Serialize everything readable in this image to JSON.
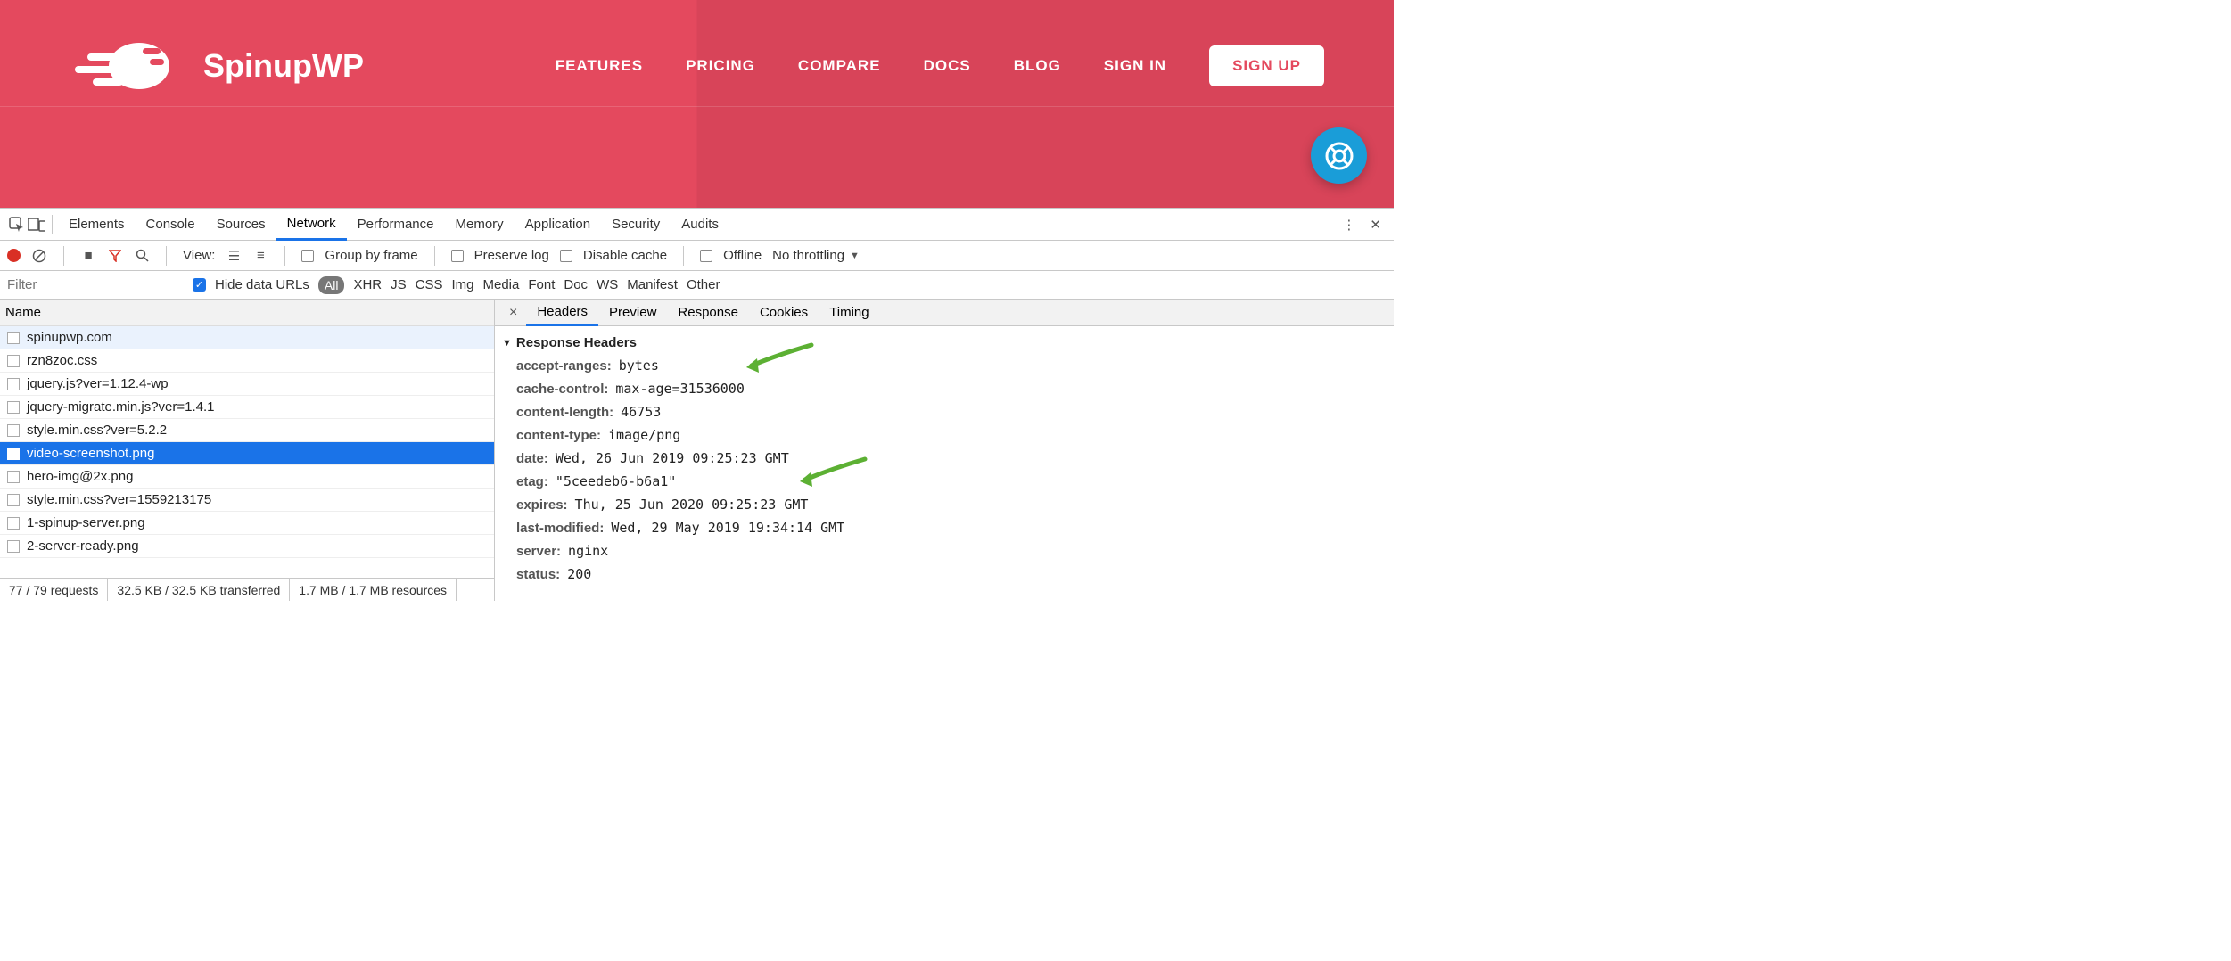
{
  "site": {
    "brand": "SpinupWP",
    "nav": [
      "FEATURES",
      "PRICING",
      "COMPARE",
      "DOCS",
      "BLOG",
      "SIGN IN"
    ],
    "signup": "SIGN UP"
  },
  "devtools": {
    "tabs": [
      "Elements",
      "Console",
      "Sources",
      "Network",
      "Performance",
      "Memory",
      "Application",
      "Security",
      "Audits"
    ],
    "active_tab": "Network",
    "toolbar": {
      "view": "View:",
      "group": "Group by frame",
      "preserve": "Preserve log",
      "disable_cache": "Disable cache",
      "offline": "Offline",
      "throttling": "No throttling"
    },
    "filter": {
      "placeholder": "Filter",
      "hide": "Hide data URLs",
      "types": [
        "All",
        "XHR",
        "JS",
        "CSS",
        "Img",
        "Media",
        "Font",
        "Doc",
        "WS",
        "Manifest",
        "Other"
      ]
    },
    "requests": {
      "header": "Name",
      "rows": [
        "spinupwp.com",
        "rzn8zoc.css",
        "jquery.js?ver=1.12.4-wp",
        "jquery-migrate.min.js?ver=1.4.1",
        "style.min.css?ver=5.2.2",
        "video-screenshot.png",
        "hero-img@2x.png",
        "style.min.css?ver=1559213175",
        "1-spinup-server.png",
        "2-server-ready.png"
      ],
      "selected_index": 5,
      "status": {
        "requests": "77 / 79 requests",
        "transferred": "32.5 KB / 32.5 KB transferred",
        "resources": "1.7 MB / 1.7 MB resources"
      }
    },
    "detail": {
      "tabs": [
        "Headers",
        "Preview",
        "Response",
        "Cookies",
        "Timing"
      ],
      "active": "Headers",
      "section": "Response Headers",
      "headers": [
        {
          "k": "accept-ranges:",
          "v": "bytes"
        },
        {
          "k": "cache-control:",
          "v": "max-age=31536000"
        },
        {
          "k": "content-length:",
          "v": "46753"
        },
        {
          "k": "content-type:",
          "v": "image/png"
        },
        {
          "k": "date:",
          "v": "Wed, 26 Jun 2019 09:25:23 GMT"
        },
        {
          "k": "etag:",
          "v": "\"5ceedeb6-b6a1\""
        },
        {
          "k": "expires:",
          "v": "Thu, 25 Jun 2020 09:25:23 GMT"
        },
        {
          "k": "last-modified:",
          "v": "Wed, 29 May 2019 19:34:14 GMT"
        },
        {
          "k": "server:",
          "v": "nginx"
        },
        {
          "k": "status:",
          "v": "200"
        }
      ]
    }
  }
}
